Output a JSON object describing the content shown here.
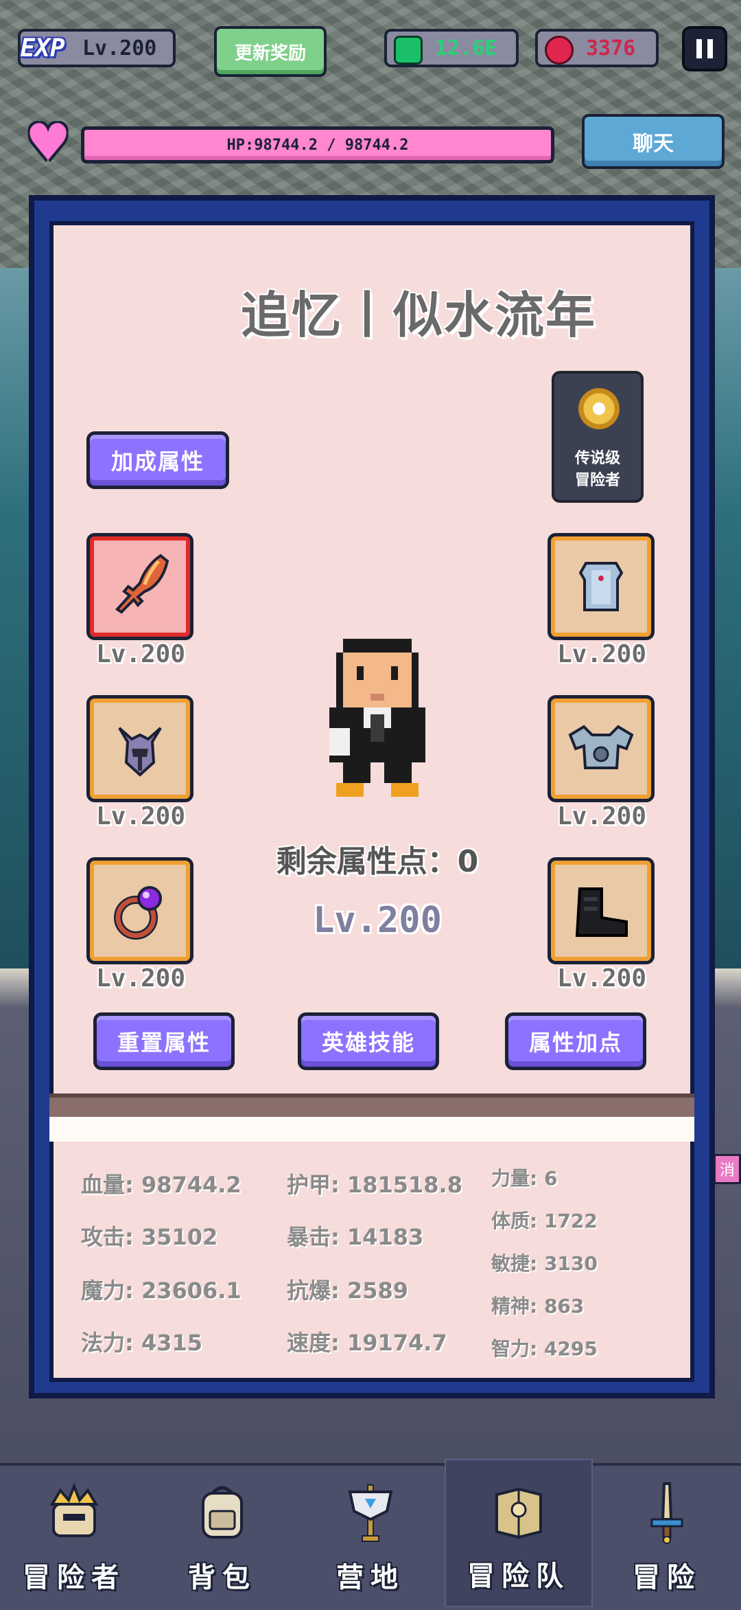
{
  "hud": {
    "exp_badge": "EXP",
    "level": "Lv.200",
    "update_reward": "更新奖励",
    "gems": "12.6E",
    "rubies": "3376",
    "hp": "HP:98744.2 / 98744.2",
    "chat": "聊天"
  },
  "panel": {
    "team_title": "追忆丨似水流年",
    "bonus_button": "加成属性",
    "legend_line1": "传说级",
    "legend_line2": "冒险者",
    "remaining_points": "剩余属性点：0",
    "hero_level": "Lv.200",
    "equipment": [
      {
        "slot": "weapon",
        "level": "Lv.200"
      },
      {
        "slot": "helmet",
        "level": "Lv.200"
      },
      {
        "slot": "ring",
        "level": "Lv.200"
      },
      {
        "slot": "chest-armor",
        "level": "Lv.200"
      },
      {
        "slot": "shoulder-armor",
        "level": "Lv.200"
      },
      {
        "slot": "boots",
        "level": "Lv.200"
      }
    ],
    "reset_button": "重置属性",
    "skill_button": "英雄技能",
    "points_button": "属性加点"
  },
  "stats": {
    "col1": [
      "血量: 98744.2",
      "攻击: 35102",
      "魔力: 23606.1",
      "法力: 4315"
    ],
    "col2": [
      "护甲: 181518.8",
      "暴击: 14183",
      "抗爆: 2589",
      "速度: 19174.7"
    ],
    "col3": [
      "力量: 6",
      "体质: 1722",
      "敏捷: 3130",
      "精神: 863",
      "智力: 4295"
    ]
  },
  "nav": [
    {
      "label": "冒险者",
      "icon": "crown-helmet-icon"
    },
    {
      "label": "背包",
      "icon": "backpack-icon"
    },
    {
      "label": "营地",
      "icon": "banner-icon"
    },
    {
      "label": "冒险队",
      "icon": "book-icon"
    },
    {
      "label": "冒险",
      "icon": "sword-icon"
    }
  ],
  "side_tag": "消",
  "colors": {
    "panel_border": "#1f3a8f",
    "panel_bg": "#f6dcda",
    "button_purple": "#8d72ff",
    "hp_pink": "#ff86cf"
  }
}
